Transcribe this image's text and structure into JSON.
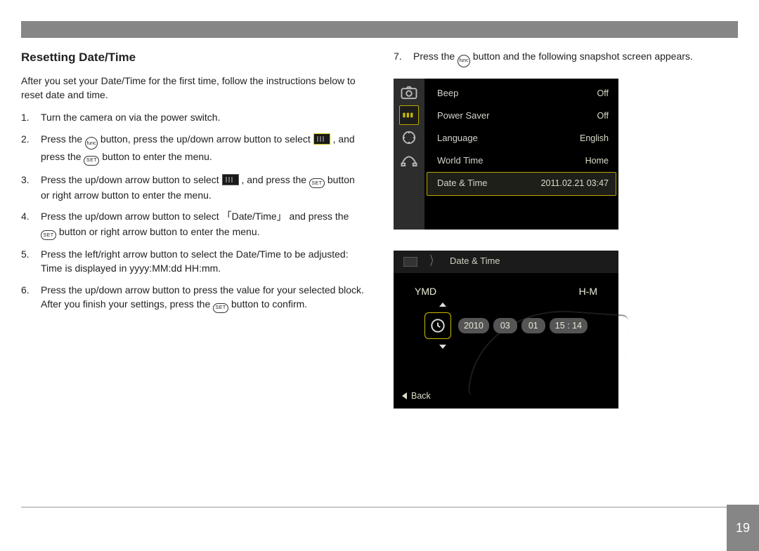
{
  "title": "Resetting Date/Time",
  "intro": "After you set your Date/Time for the first time, follow the instructions below to reset date and time.",
  "icons": {
    "func": "func",
    "set": "SET"
  },
  "steps": {
    "s1": "Turn the camera on via the power switch.",
    "s2a": "Press the ",
    "s2b": " button, press the up/down arrow button to select ",
    "s2c": " , and press the ",
    "s2d": " button to enter the menu.",
    "s3a": "Press the up/down arrow button to select ",
    "s3b": " , and press the ",
    "s3c": " button or right arrow button to enter the menu.",
    "s4a": "Press the up/down arrow button to select",
    "s4q": "Date/Time",
    "s4b": "and press the ",
    "s4c": " button or right arrow button to enter the menu.",
    "s5": "Press the left/right arrow button to select the Date/Time to be adjusted: Time is displayed in yyyy:MM:dd HH:mm.",
    "s6a": "Press the up/down arrow button to press the value for your selected block. After you finish your settings, press the ",
    "s6b": " button to confirm.",
    "s7a": "Press the ",
    "s7b": " button and the following snapshot screen appears."
  },
  "menu": {
    "rows": [
      {
        "label": "Beep",
        "value": "Off"
      },
      {
        "label": "Power Saver",
        "value": "Off"
      },
      {
        "label": "Language",
        "value": "English"
      },
      {
        "label": "World Time",
        "value": "Home"
      },
      {
        "label": "Date & Time",
        "value": "2011.02.21 03:47"
      }
    ]
  },
  "datescreen": {
    "title": "Date & Time",
    "ymd": "YMD",
    "hm": "H-M",
    "year": "2010",
    "month": "03",
    "day": "01",
    "time": "15 : 14",
    "back": "Back"
  },
  "page_number": "19"
}
